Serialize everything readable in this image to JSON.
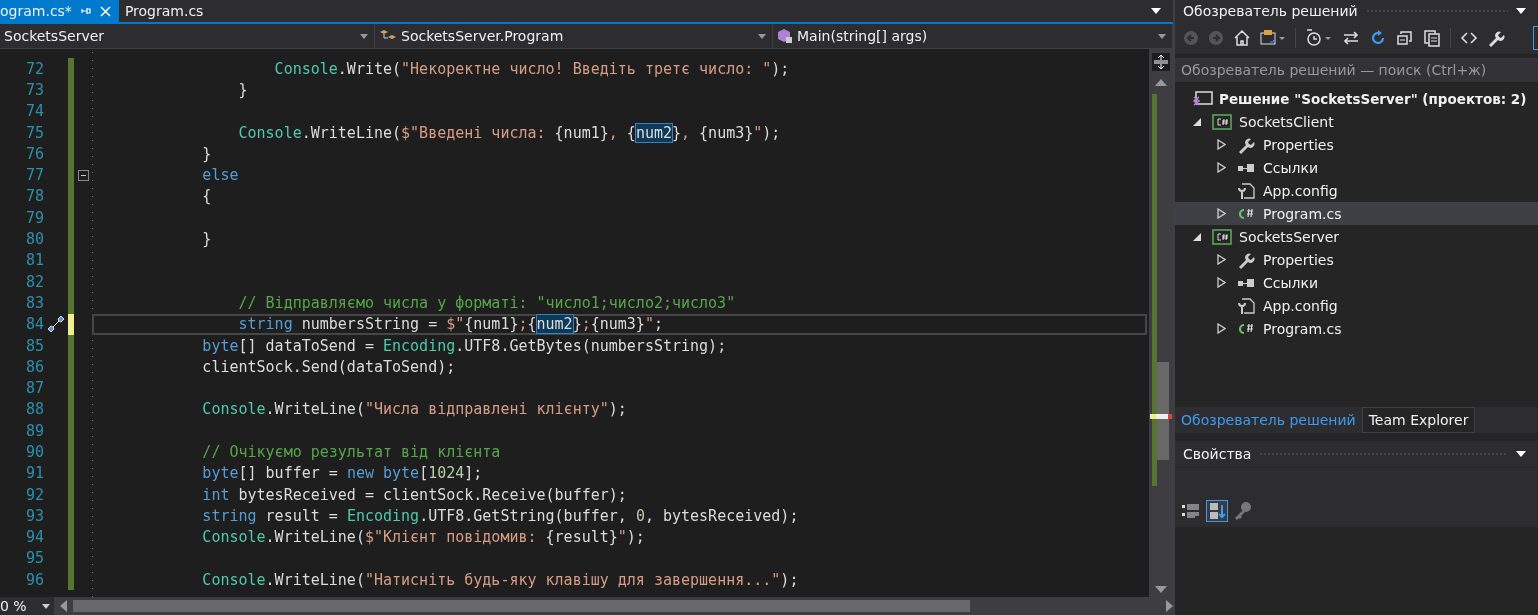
{
  "tabs": [
    {
      "label": "ogram.cs*",
      "selected": true,
      "pinnable": true
    },
    {
      "label": "Program.cs",
      "selected": false,
      "pinnable": false
    }
  ],
  "nav_bar": [
    "SocketsServer",
    "SocketsServer.Program",
    "Main(string[] args)"
  ],
  "code_lines": [
    {
      "n": "72",
      "t": [
        {
          "text": "                    Console",
          "kind": "type"
        },
        {
          "text": ".Write(",
          "kind": "plain"
        },
        {
          "text": "\"Некоректне число! Введіть третє число: \"",
          "kind": "string"
        },
        {
          "text": ");",
          "kind": "plain"
        }
      ],
      "current": false,
      "unsaved": false
    },
    {
      "n": "73",
      "t": [
        {
          "text": "                }",
          "kind": "plain"
        }
      ],
      "current": false,
      "unsaved": false
    },
    {
      "n": "74",
      "current": false,
      "unsaved": false
    },
    {
      "n": "75",
      "t": [
        {
          "text": "                Console",
          "kind": "type"
        },
        {
          "text": ".WriteLine(",
          "kind": "plain"
        },
        {
          "text": "$\"Введені числа: ",
          "kind": "string"
        },
        {
          "text": "{num1}",
          "kind": "plain"
        },
        {
          "text": ", ",
          "kind": "string"
        },
        {
          "text": "{",
          "kind": "plain"
        },
        {
          "text": "num2",
          "kind": "match"
        },
        {
          "text": "}",
          "kind": "plain"
        },
        {
          "text": ", ",
          "kind": "string"
        },
        {
          "text": "{num3}",
          "kind": "plain"
        },
        {
          "text": "\"",
          "kind": "string"
        },
        {
          "text": ");",
          "kind": "plain"
        }
      ],
      "current": false,
      "unsaved": false
    },
    {
      "n": "76",
      "t": [
        {
          "text": "            }",
          "kind": "plain"
        }
      ],
      "current": false,
      "unsaved": false
    },
    {
      "n": "77",
      "t": [
        {
          "text": "            else",
          "kind": "keyword"
        }
      ],
      "current": false,
      "unsaved": false,
      "fold": true
    },
    {
      "n": "78",
      "t": [
        {
          "text": "            {",
          "kind": "plain"
        }
      ],
      "current": false,
      "unsaved": false
    },
    {
      "n": "79",
      "current": false,
      "unsaved": false
    },
    {
      "n": "80",
      "t": [
        {
          "text": "            }",
          "kind": "plain"
        }
      ],
      "current": false,
      "unsaved": false
    },
    {
      "n": "81",
      "current": false,
      "unsaved": false
    },
    {
      "n": "82",
      "current": false,
      "unsaved": false
    },
    {
      "n": "83",
      "t": [
        {
          "text": "                // Відправляємо числа у форматі: \"число1;число2;число3\"",
          "kind": "comment"
        }
      ],
      "current": false,
      "unsaved": false
    },
    {
      "n": "84",
      "t": [
        {
          "text": "                string",
          "kind": "keyword"
        },
        {
          "text": " numbersString = ",
          "kind": "plain"
        },
        {
          "text": "$\"",
          "kind": "string"
        },
        {
          "text": "{num1}",
          "kind": "plain"
        },
        {
          "text": ";",
          "kind": "string"
        },
        {
          "text": "{",
          "kind": "plain"
        },
        {
          "text": "num2",
          "kind": "match"
        },
        {
          "text": "}",
          "kind": "plain"
        },
        {
          "text": ";",
          "kind": "string"
        },
        {
          "text": "{num3}",
          "kind": "plain"
        },
        {
          "text": "\"",
          "kind": "string"
        },
        {
          "text": ";",
          "kind": "plain"
        }
      ],
      "current": true,
      "unsaved": true,
      "quick_action": true
    },
    {
      "n": "85",
      "t": [
        {
          "text": "            byte",
          "kind": "keyword"
        },
        {
          "text": "[] dataToSend = ",
          "kind": "plain"
        },
        {
          "text": "Encoding",
          "kind": "type"
        },
        {
          "text": ".UTF8.GetBytes(numbersString);",
          "kind": "plain"
        }
      ],
      "current": false,
      "unsaved": false
    },
    {
      "n": "86",
      "t": [
        {
          "text": "            clientSock.Send(dataToSend);",
          "kind": "plain"
        }
      ],
      "current": false,
      "unsaved": false
    },
    {
      "n": "87",
      "current": false,
      "unsaved": false
    },
    {
      "n": "88",
      "t": [
        {
          "text": "            Console",
          "kind": "type"
        },
        {
          "text": ".WriteLine(",
          "kind": "plain"
        },
        {
          "text": "\"Числа відправлені клієнту\"",
          "kind": "string"
        },
        {
          "text": ");",
          "kind": "plain"
        }
      ],
      "current": false,
      "unsaved": false
    },
    {
      "n": "89",
      "current": false,
      "unsaved": false
    },
    {
      "n": "90",
      "t": [
        {
          "text": "            // Очікуємо результат від клієнта",
          "kind": "comment"
        }
      ],
      "current": false,
      "unsaved": false
    },
    {
      "n": "91",
      "t": [
        {
          "text": "            byte",
          "kind": "keyword"
        },
        {
          "text": "[] buffer = ",
          "kind": "plain"
        },
        {
          "text": "new byte",
          "kind": "keyword"
        },
        {
          "text": "[",
          "kind": "plain"
        },
        {
          "text": "1024",
          "kind": "number"
        },
        {
          "text": "];",
          "kind": "plain"
        }
      ],
      "current": false,
      "unsaved": false
    },
    {
      "n": "92",
      "t": [
        {
          "text": "            int",
          "kind": "keyword"
        },
        {
          "text": " bytesReceived = clientSock.Receive(buffer);",
          "kind": "plain"
        }
      ],
      "current": false,
      "unsaved": false
    },
    {
      "n": "93",
      "t": [
        {
          "text": "            string",
          "kind": "keyword"
        },
        {
          "text": " result = ",
          "kind": "plain"
        },
        {
          "text": "Encoding",
          "kind": "type"
        },
        {
          "text": ".UTF8.GetString(buffer, ",
          "kind": "plain"
        },
        {
          "text": "0",
          "kind": "number"
        },
        {
          "text": ", bytesReceived);",
          "kind": "plain"
        }
      ],
      "current": false,
      "unsaved": false
    },
    {
      "n": "94",
      "t": [
        {
          "text": "            Console",
          "kind": "type"
        },
        {
          "text": ".WriteLine(",
          "kind": "plain"
        },
        {
          "text": "$\"Клієнт повідомив: ",
          "kind": "string"
        },
        {
          "text": "{result}",
          "kind": "plain"
        },
        {
          "text": "\"",
          "kind": "string"
        },
        {
          "text": ");",
          "kind": "plain"
        }
      ],
      "current": false,
      "unsaved": false
    },
    {
      "n": "95",
      "current": false,
      "unsaved": false
    },
    {
      "n": "96",
      "t": [
        {
          "text": "            Console",
          "kind": "type"
        },
        {
          "text": ".WriteLine(",
          "kind": "plain"
        },
        {
          "text": "\"Натисніть будь-яку клавішу для завершення...\"",
          "kind": "string"
        },
        {
          "text": ");",
          "kind": "plain"
        }
      ],
      "current": false,
      "unsaved": false
    }
  ],
  "zoom": "0 %",
  "solution_explorer": {
    "title": "Обозреватель решений",
    "search": {
      "placeholder": "Обозреватель решений — поиск (Ctrl+ж)"
    },
    "solution": "Решение \"SocketsServer\"  (проектов: 2)",
    "projects": [
      {
        "label": "SocketsClient",
        "kind": "project",
        "expanded": true,
        "selected": false,
        "children": [
          {
            "label": "Properties",
            "kind": "properties",
            "expanded": false,
            "selected": false
          },
          {
            "label": "Ссылки",
            "kind": "references",
            "expanded": false,
            "selected": false
          },
          {
            "label": "App.config",
            "kind": "config",
            "selected": false
          },
          {
            "label": "Program.cs",
            "kind": "csfile",
            "expanded": false,
            "selected": true
          }
        ]
      },
      {
        "label": "SocketsServer",
        "kind": "project",
        "expanded": true,
        "selected": false,
        "children": [
          {
            "label": "Properties",
            "kind": "properties",
            "expanded": false,
            "selected": false
          },
          {
            "label": "Ссылки",
            "kind": "references",
            "expanded": false,
            "selected": false
          },
          {
            "label": "App.config",
            "kind": "config",
            "selected": false
          },
          {
            "label": "Program.cs",
            "kind": "csfile",
            "expanded": false,
            "selected": false
          }
        ]
      }
    ]
  },
  "bottom_tabs": [
    {
      "label": "Обозреватель решений",
      "selected": true
    },
    {
      "label": "Team Explorer",
      "selected": false
    }
  ],
  "properties": {
    "title": "Свойства"
  }
}
